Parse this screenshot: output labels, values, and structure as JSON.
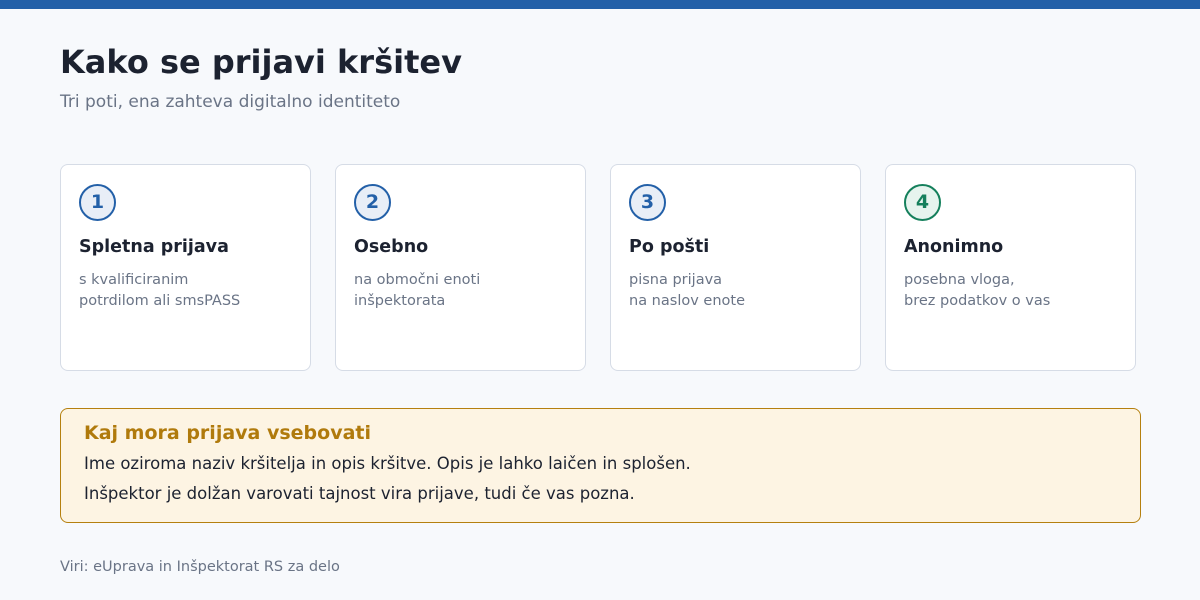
{
  "header": {
    "title": "Kako se prijavi kršitev",
    "subtitle": "Tri poti, ena zahteva digitalno identiteto"
  },
  "cards": [
    {
      "number": "1",
      "title": "Spletna prijava",
      "lines": [
        "s kvalificiranim",
        "potrdilom ali smsPASS"
      ],
      "accent": "#2360a8"
    },
    {
      "number": "2",
      "title": "Osebno",
      "lines": [
        "na območni enoti",
        "inšpektorata"
      ],
      "accent": "#2360a8"
    },
    {
      "number": "3",
      "title": "Po pošti",
      "lines": [
        "pisna prijava",
        "na naslov enote"
      ],
      "accent": "#2360a8"
    },
    {
      "number": "4",
      "title": "Anonimno",
      "lines": [
        "posebna vloga,",
        "brez podatkov o vas"
      ],
      "accent": "#15805c"
    }
  ],
  "notice": {
    "title": "Kaj mora prijava vsebovati",
    "line1": "Ime oziroma naziv kršitelja in opis kršitve. Opis je lahko laičen in splošen.",
    "line2": "Inšpektor je dolžan varovati tajnost vira prijave, tudi če vas pozna."
  },
  "footer": {
    "sources": "Viri: eUprava in Inšpektorat RS za delo"
  },
  "colors": {
    "top_bar": "#2360a8",
    "step_blue": "#2360a8",
    "step_green": "#15805c",
    "notice_accent": "#b07a0c",
    "notice_background": "#fdf4e3"
  }
}
